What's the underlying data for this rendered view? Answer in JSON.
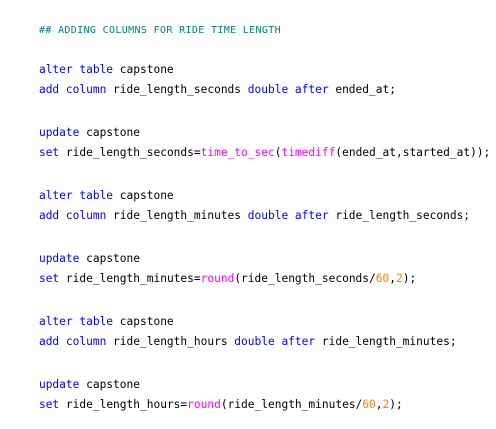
{
  "editor": {
    "colors": {
      "comment": "#008080",
      "keyword": "#0000ff",
      "function": "#ff00ff",
      "number": "#ff8000",
      "text": "#000000",
      "background": "#ffffff"
    },
    "lines": [
      [
        {
          "t": "comment",
          "v": "## ADDING COLUMNS FOR RIDE TIME LENGTH"
        }
      ],
      [],
      [
        {
          "t": "kw",
          "v": "alter table"
        },
        {
          "t": "plain",
          "v": " capstone"
        }
      ],
      [
        {
          "t": "kw",
          "v": "add column"
        },
        {
          "t": "plain",
          "v": " ride_length_seconds "
        },
        {
          "t": "kw",
          "v": "double after"
        },
        {
          "t": "plain",
          "v": " ended_at;"
        }
      ],
      [],
      [
        {
          "t": "kw",
          "v": "update"
        },
        {
          "t": "plain",
          "v": " capstone"
        }
      ],
      [
        {
          "t": "kw",
          "v": "set"
        },
        {
          "t": "plain",
          "v": " ride_length_seconds="
        },
        {
          "t": "fn",
          "v": "time_to_sec"
        },
        {
          "t": "plain",
          "v": "("
        },
        {
          "t": "fn",
          "v": "timediff"
        },
        {
          "t": "plain",
          "v": "(ended_at,started_at));"
        }
      ],
      [],
      [
        {
          "t": "kw",
          "v": "alter table"
        },
        {
          "t": "plain",
          "v": " capstone"
        }
      ],
      [
        {
          "t": "kw",
          "v": "add column"
        },
        {
          "t": "plain",
          "v": " ride_length_minutes "
        },
        {
          "t": "kw",
          "v": "double after"
        },
        {
          "t": "plain",
          "v": " ride_length_seconds;"
        }
      ],
      [],
      [
        {
          "t": "kw",
          "v": "update"
        },
        {
          "t": "plain",
          "v": " capstone"
        }
      ],
      [
        {
          "t": "kw",
          "v": "set"
        },
        {
          "t": "plain",
          "v": " ride_length_minutes="
        },
        {
          "t": "fn",
          "v": "round"
        },
        {
          "t": "plain",
          "v": "(ride_length_seconds/"
        },
        {
          "t": "num",
          "v": "60"
        },
        {
          "t": "plain",
          "v": ","
        },
        {
          "t": "num",
          "v": "2"
        },
        {
          "t": "plain",
          "v": ");"
        }
      ],
      [],
      [
        {
          "t": "kw",
          "v": "alter table"
        },
        {
          "t": "plain",
          "v": " capstone"
        }
      ],
      [
        {
          "t": "kw",
          "v": "add column"
        },
        {
          "t": "plain",
          "v": " ride_length_hours "
        },
        {
          "t": "kw",
          "v": "double after"
        },
        {
          "t": "plain",
          "v": " ride_length_minutes;"
        }
      ],
      [],
      [
        {
          "t": "kw",
          "v": "update"
        },
        {
          "t": "plain",
          "v": " capstone"
        }
      ],
      [
        {
          "t": "kw",
          "v": "set"
        },
        {
          "t": "plain",
          "v": " ride_length_hours="
        },
        {
          "t": "fn",
          "v": "round"
        },
        {
          "t": "plain",
          "v": "(ride_length_minutes/"
        },
        {
          "t": "num",
          "v": "60"
        },
        {
          "t": "plain",
          "v": ","
        },
        {
          "t": "num",
          "v": "2"
        },
        {
          "t": "plain",
          "v": ");"
        }
      ]
    ]
  }
}
